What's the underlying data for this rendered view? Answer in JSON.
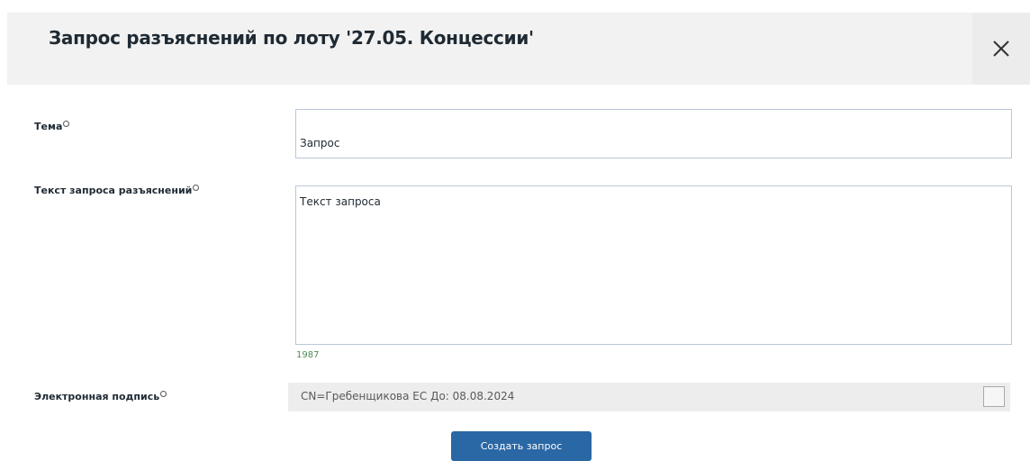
{
  "dialog": {
    "title": "Запрос разъяснений по лоту '27.05. Концессии'"
  },
  "form": {
    "topic": {
      "label": "Тема",
      "value": "Запрос"
    },
    "request_text": {
      "label": "Текст запроса разъяснений",
      "value": "Текст запроса",
      "char_counter": "1987"
    },
    "signature": {
      "label": "Электронная подпись",
      "value": "CN=Гребенщикова ЕС До: 08.08.2024"
    },
    "submit_label": "Создать запрос"
  },
  "icons": {
    "close": "close-icon",
    "required": "required-marker-icon"
  },
  "colors": {
    "header_bg": "#f2f2f2",
    "primary_button": "#2a67a5",
    "input_border": "#b9c7d8",
    "counter_text": "#4f8c5a",
    "signature_bg": "#ededed"
  }
}
